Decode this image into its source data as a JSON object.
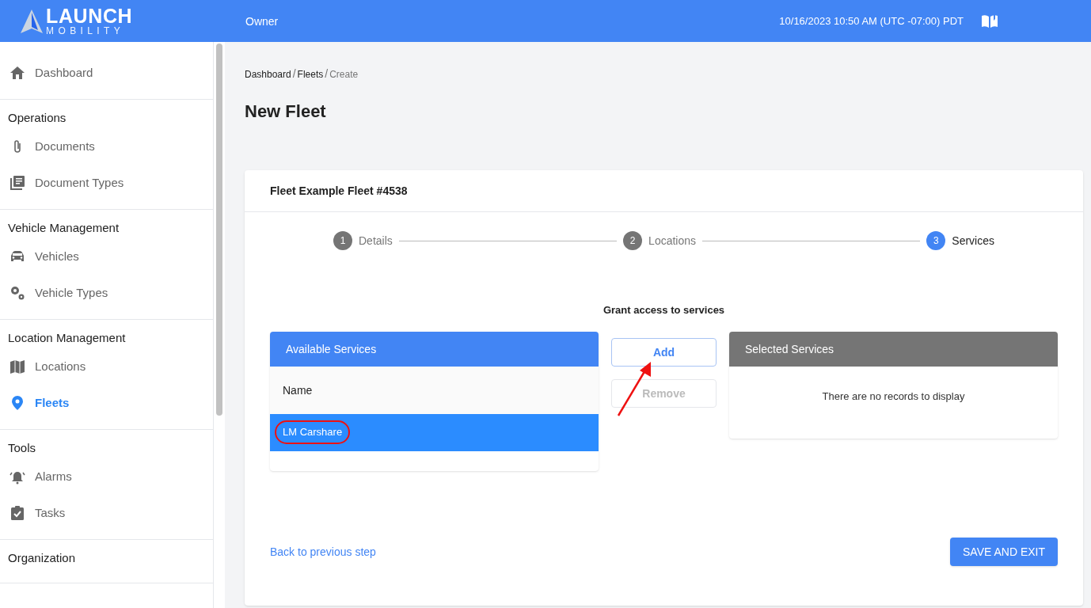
{
  "header": {
    "logo_title": "LAUNCH",
    "logo_subtitle": "MOBILITY",
    "role": "Owner",
    "datetime": "10/16/2023 10:50 AM (UTC -07:00) PDT"
  },
  "sidebar": {
    "sections": [
      {
        "items": [
          {
            "label": "Dashboard",
            "kind": "home",
            "selected": false
          }
        ]
      },
      {
        "heading": "Operations",
        "items": [
          {
            "label": "Documents",
            "kind": "paperclip",
            "selected": false
          },
          {
            "label": "Document Types",
            "kind": "library",
            "selected": false
          }
        ]
      },
      {
        "heading": "Vehicle Management",
        "items": [
          {
            "label": "Vehicles",
            "kind": "car",
            "selected": false
          },
          {
            "label": "Vehicle Types",
            "kind": "gears",
            "selected": false
          }
        ]
      },
      {
        "heading": "Location Management",
        "items": [
          {
            "label": "Locations",
            "kind": "map",
            "selected": false
          },
          {
            "label": "Fleets",
            "kind": "pin",
            "selected": true
          }
        ]
      },
      {
        "heading": "Tools",
        "items": [
          {
            "label": "Alarms",
            "kind": "bell",
            "selected": false
          },
          {
            "label": "Tasks",
            "kind": "clipboard",
            "selected": false
          }
        ]
      },
      {
        "heading": "Organization"
      }
    ]
  },
  "breadcrumb": {
    "separator": "/",
    "items": [
      {
        "label": "Dashboard",
        "current": false
      },
      {
        "label": "Fleets",
        "current": false
      },
      {
        "label": "Create",
        "current": true
      }
    ]
  },
  "page_title": "New Fleet",
  "card": {
    "title": "Fleet Example Fleet #4538",
    "steps": [
      {
        "number": "1",
        "label": "Details",
        "selected": false
      },
      {
        "number": "2",
        "label": "Locations",
        "selected": false
      },
      {
        "number": "3",
        "label": "Services",
        "selected": true
      }
    ],
    "section_title": "Grant access to services",
    "available": {
      "title": "Available Services",
      "column": "Name",
      "rows": [
        {
          "label": "LM Carshare",
          "selected": true
        }
      ]
    },
    "buttons": [
      {
        "label": "Add",
        "disabled": false
      },
      {
        "label": "Remove",
        "disabled": true
      }
    ],
    "selected_list": {
      "title": "Selected Services",
      "empty_text": "There are no records to display"
    },
    "back_link": "Back to previous step",
    "save_button": "SAVE AND EXIT"
  }
}
